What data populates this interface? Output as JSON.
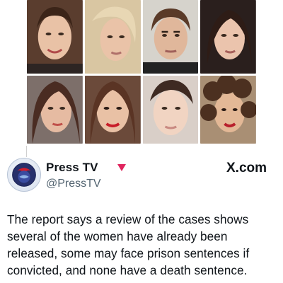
{
  "photos": [
    {
      "name": "photo-1"
    },
    {
      "name": "photo-2"
    },
    {
      "name": "photo-3"
    },
    {
      "name": "photo-4"
    },
    {
      "name": "photo-5"
    },
    {
      "name": "photo-6"
    },
    {
      "name": "photo-7"
    },
    {
      "name": "photo-8"
    }
  ],
  "tweet": {
    "display_name": "Press TV",
    "badge_icon": "red-triangle-government-badge-icon",
    "badge_color": "#e0245e",
    "handle": "@PressTV",
    "source_label": "X.com",
    "text": "The report says a review of the cases shows several of the women have already been released, some may face prison sentences if convicted, and none have a death sentence."
  },
  "colors": {
    "text_primary": "#0f1419",
    "text_secondary": "#536471",
    "background": "#ffffff"
  }
}
